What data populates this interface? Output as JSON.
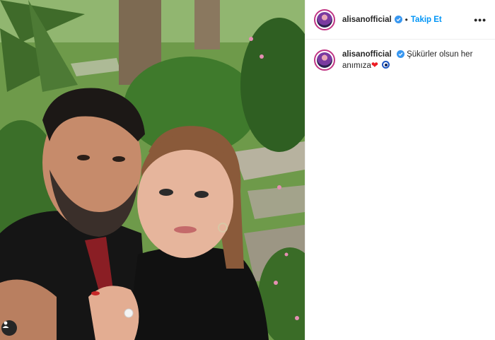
{
  "post": {
    "header": {
      "username": "alisanofficial",
      "follow_label": "Takip Et",
      "separator": "•",
      "more_label": "•••"
    },
    "caption": {
      "username": "alisanofficial",
      "text": "Şükürler olsun her anımıza",
      "heart": "❤"
    }
  },
  "colors": {
    "follow_blue": "#0095f6",
    "verified_blue": "#3897f0",
    "text": "#262626"
  }
}
